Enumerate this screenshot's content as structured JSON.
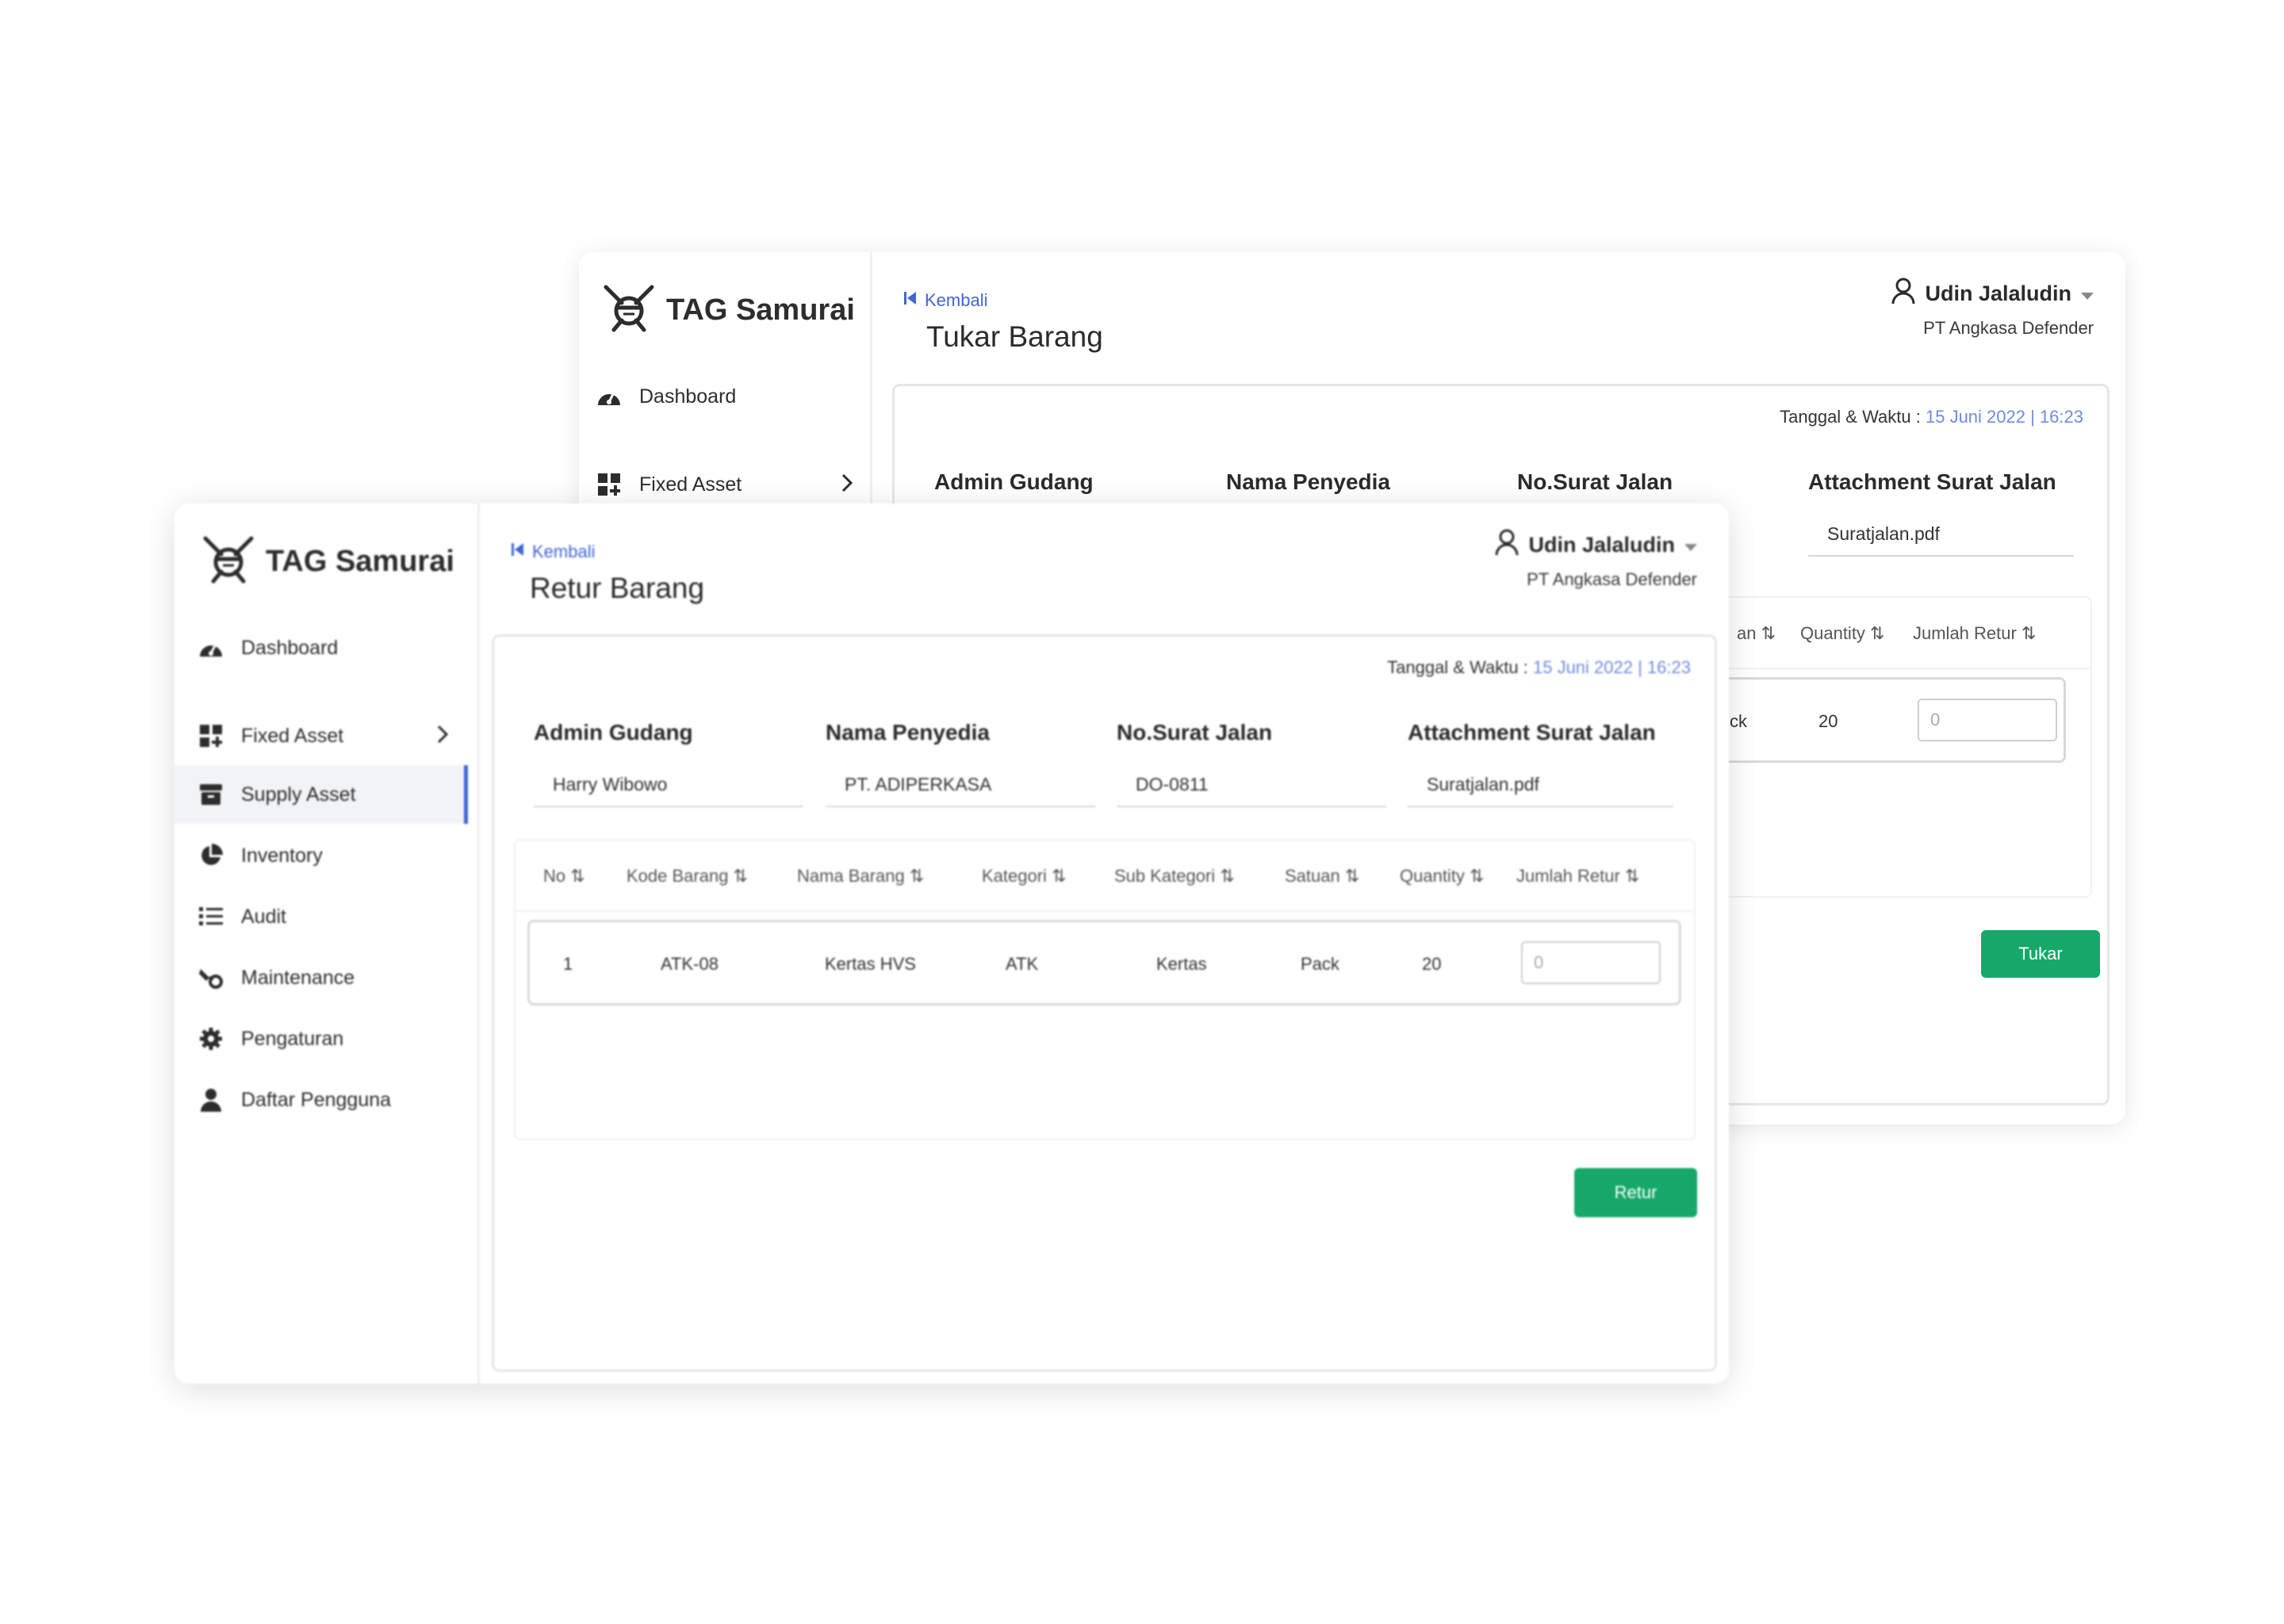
{
  "back_window": {
    "brand": "TAG Samurai",
    "nav": [
      {
        "label": "Dashboard",
        "icon": "dashboard-icon"
      },
      {
        "label": "Fixed Asset",
        "icon": "fixed-asset-icon"
      }
    ],
    "back_label": "Kembali",
    "page_title": "Tukar Barang",
    "user": {
      "name": "Udin Jalaludin",
      "company": "PT Angkasa Defender"
    },
    "datetime": {
      "label": "Tanggal & Waktu",
      "date": "15 Juni 2022",
      "time": "16:23"
    },
    "fields": [
      {
        "label": "Admin Gudang",
        "value": ""
      },
      {
        "label": "Nama Penyedia",
        "value": ""
      },
      {
        "label": "No.Surat Jalan",
        "value": ""
      },
      {
        "label": "Attachment Surat  Jalan",
        "value": "Suratjalan.pdf"
      }
    ],
    "table_headers_visible": [
      "an",
      "Quantity",
      "Jumlah Retur"
    ],
    "row": {
      "satuan_fragment": "ck",
      "quantity": "20",
      "jumlah_placeholder": "0"
    },
    "submit_label": "Tukar"
  },
  "front_window": {
    "brand": "TAG Samurai",
    "nav": [
      {
        "label": "Dashboard",
        "icon": "dashboard-icon"
      },
      {
        "label": "Fixed Asset",
        "icon": "fixed-asset-icon"
      },
      {
        "label": "Supply Asset",
        "icon": "supply-asset-icon"
      },
      {
        "label": "Inventory",
        "icon": "inventory-icon"
      },
      {
        "label": "Audit",
        "icon": "audit-icon"
      },
      {
        "label": "Maintenance",
        "icon": "maintenance-icon"
      },
      {
        "label": "Pengaturan",
        "icon": "settings-icon"
      },
      {
        "label": "Daftar Pengguna",
        "icon": "user-list-icon"
      }
    ],
    "active_nav": "Supply Asset",
    "back_label": "Kembali",
    "page_title": "Retur Barang",
    "user": {
      "name": "Udin Jalaludin",
      "company": "PT Angkasa Defender"
    },
    "datetime": {
      "label": "Tanggal & Waktu",
      "date": "15 Juni 2022",
      "time": "16:23"
    },
    "fields": [
      {
        "label": "Admin Gudang",
        "value": "Harry Wibowo"
      },
      {
        "label": "Nama Penyedia",
        "value": "PT. ADIPERKASA"
      },
      {
        "label": "No.Surat Jalan",
        "value": "DO-0811"
      },
      {
        "label": "Attachment Surat  Jalan",
        "value": "Suratjalan.pdf"
      }
    ],
    "table_headers": [
      "No",
      "Kode Barang",
      "Nama Barang",
      "Kategori",
      "Sub Kategori",
      "Satuan",
      "Quantity",
      "Jumlah Retur"
    ],
    "rows": [
      {
        "no": "1",
        "kode": "ATK-08",
        "nama": "Kertas HVS",
        "kategori": "ATK",
        "sub_kategori": "Kertas",
        "satuan": "Pack",
        "quantity": "20",
        "jumlah_placeholder": "0"
      }
    ],
    "submit_label": "Retur"
  },
  "colors": {
    "accent": "#4166d5",
    "button": "#15a86a",
    "date_text": "#6f8be0",
    "active_bg": "#f2f3f5"
  }
}
